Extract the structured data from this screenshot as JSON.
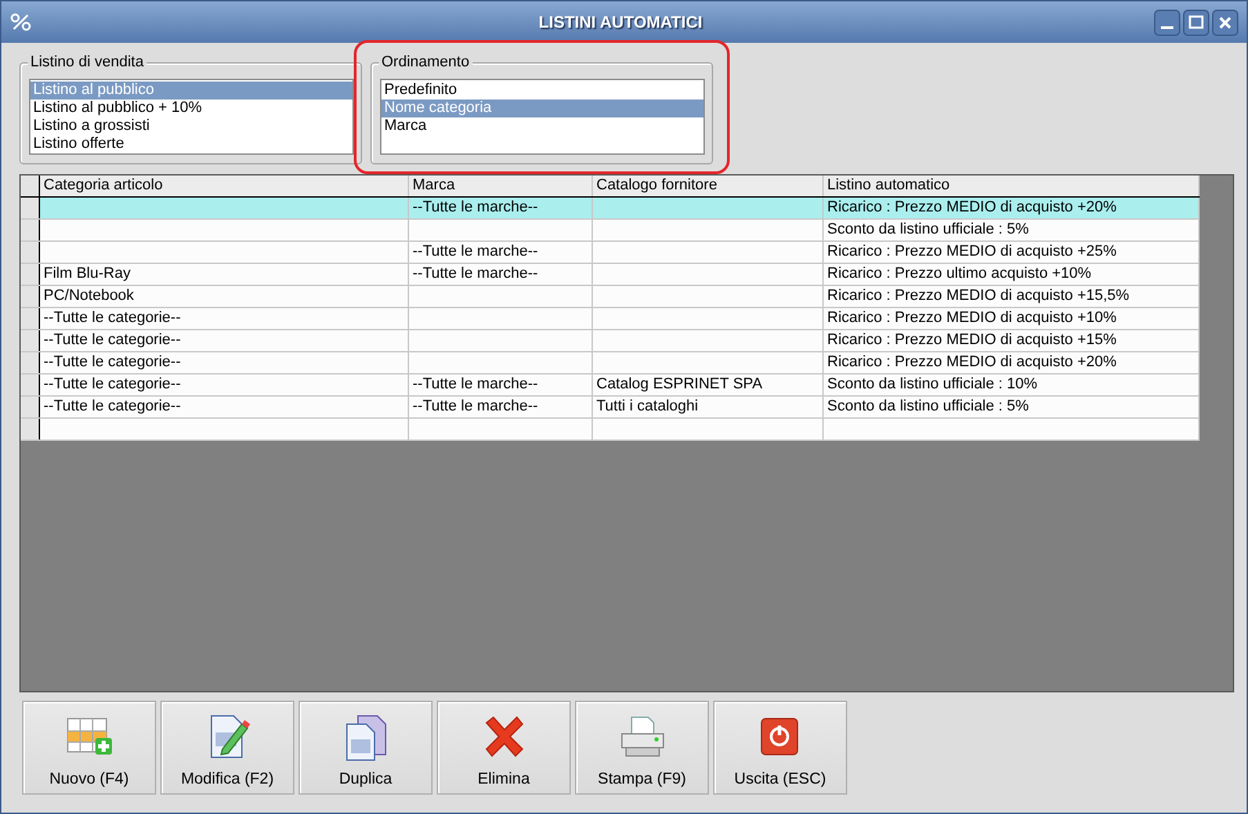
{
  "window": {
    "title": "LISTINI AUTOMATICI"
  },
  "price_lists": {
    "label": "Listino di vendita",
    "items": [
      {
        "label": "Listino al pubblico",
        "selected": true
      },
      {
        "label": "Listino al pubblico + 10%",
        "selected": false
      },
      {
        "label": "Listino a grossisti",
        "selected": false
      },
      {
        "label": "Listino offerte",
        "selected": false
      }
    ]
  },
  "sorting": {
    "label": "Ordinamento",
    "highlighted": true,
    "items": [
      {
        "label": "Predefinito",
        "selected": false
      },
      {
        "label": "Nome categoria",
        "selected": true
      },
      {
        "label": "Marca",
        "selected": false
      }
    ]
  },
  "table": {
    "columns": [
      "Categoria articolo",
      "Marca",
      "Catalogo fornitore",
      "Listino automatico"
    ],
    "rows": [
      {
        "selected": true,
        "brand": "--Tutte le marche--",
        "price_rule": "Ricarico : Prezzo MEDIO di acquisto +20%"
      },
      {
        "selected": false,
        "price_rule": "Sconto da listino ufficiale : 5%"
      },
      {
        "selected": false,
        "brand": "--Tutte le marche--",
        "price_rule": "Ricarico : Prezzo MEDIO di acquisto +25%"
      },
      {
        "selected": false,
        "category": "Film Blu-Ray",
        "brand": "--Tutte le marche--",
        "price_rule": "Ricarico : Prezzo ultimo acquisto +10%"
      },
      {
        "selected": false,
        "category": "PC/Notebook",
        "price_rule": "Ricarico : Prezzo MEDIO di acquisto +15,5%"
      },
      {
        "selected": false,
        "category": "--Tutte le categorie--",
        "price_rule": "Ricarico : Prezzo MEDIO di acquisto +10%"
      },
      {
        "selected": false,
        "category": "--Tutte le categorie--",
        "price_rule": "Ricarico : Prezzo MEDIO di acquisto +15%"
      },
      {
        "selected": false,
        "category": "--Tutte le categorie--",
        "price_rule": "Ricarico : Prezzo MEDIO di acquisto +20%"
      },
      {
        "selected": false,
        "category": "--Tutte le categorie--",
        "brand": "--Tutte le marche--",
        "catalog": "Catalog ESPRINET SPA",
        "price_rule": "Sconto da listino ufficiale : 10%"
      },
      {
        "selected": false,
        "category": "--Tutte le categorie--",
        "brand": "--Tutte le marche--",
        "catalog": "Tutti i cataloghi",
        "price_rule": "Sconto da listino ufficiale : 5%"
      }
    ]
  },
  "buttons": [
    {
      "label": "Nuovo (F4)",
      "kind": "new"
    },
    {
      "label": "Modifica (F2)",
      "kind": "edit"
    },
    {
      "label": "Duplica",
      "kind": "duplicate"
    },
    {
      "label": "Elimina",
      "kind": "delete"
    },
    {
      "label": "Stampa (F9)",
      "kind": "print"
    },
    {
      "label": "Uscita (ESC)",
      "kind": "exit"
    }
  ]
}
